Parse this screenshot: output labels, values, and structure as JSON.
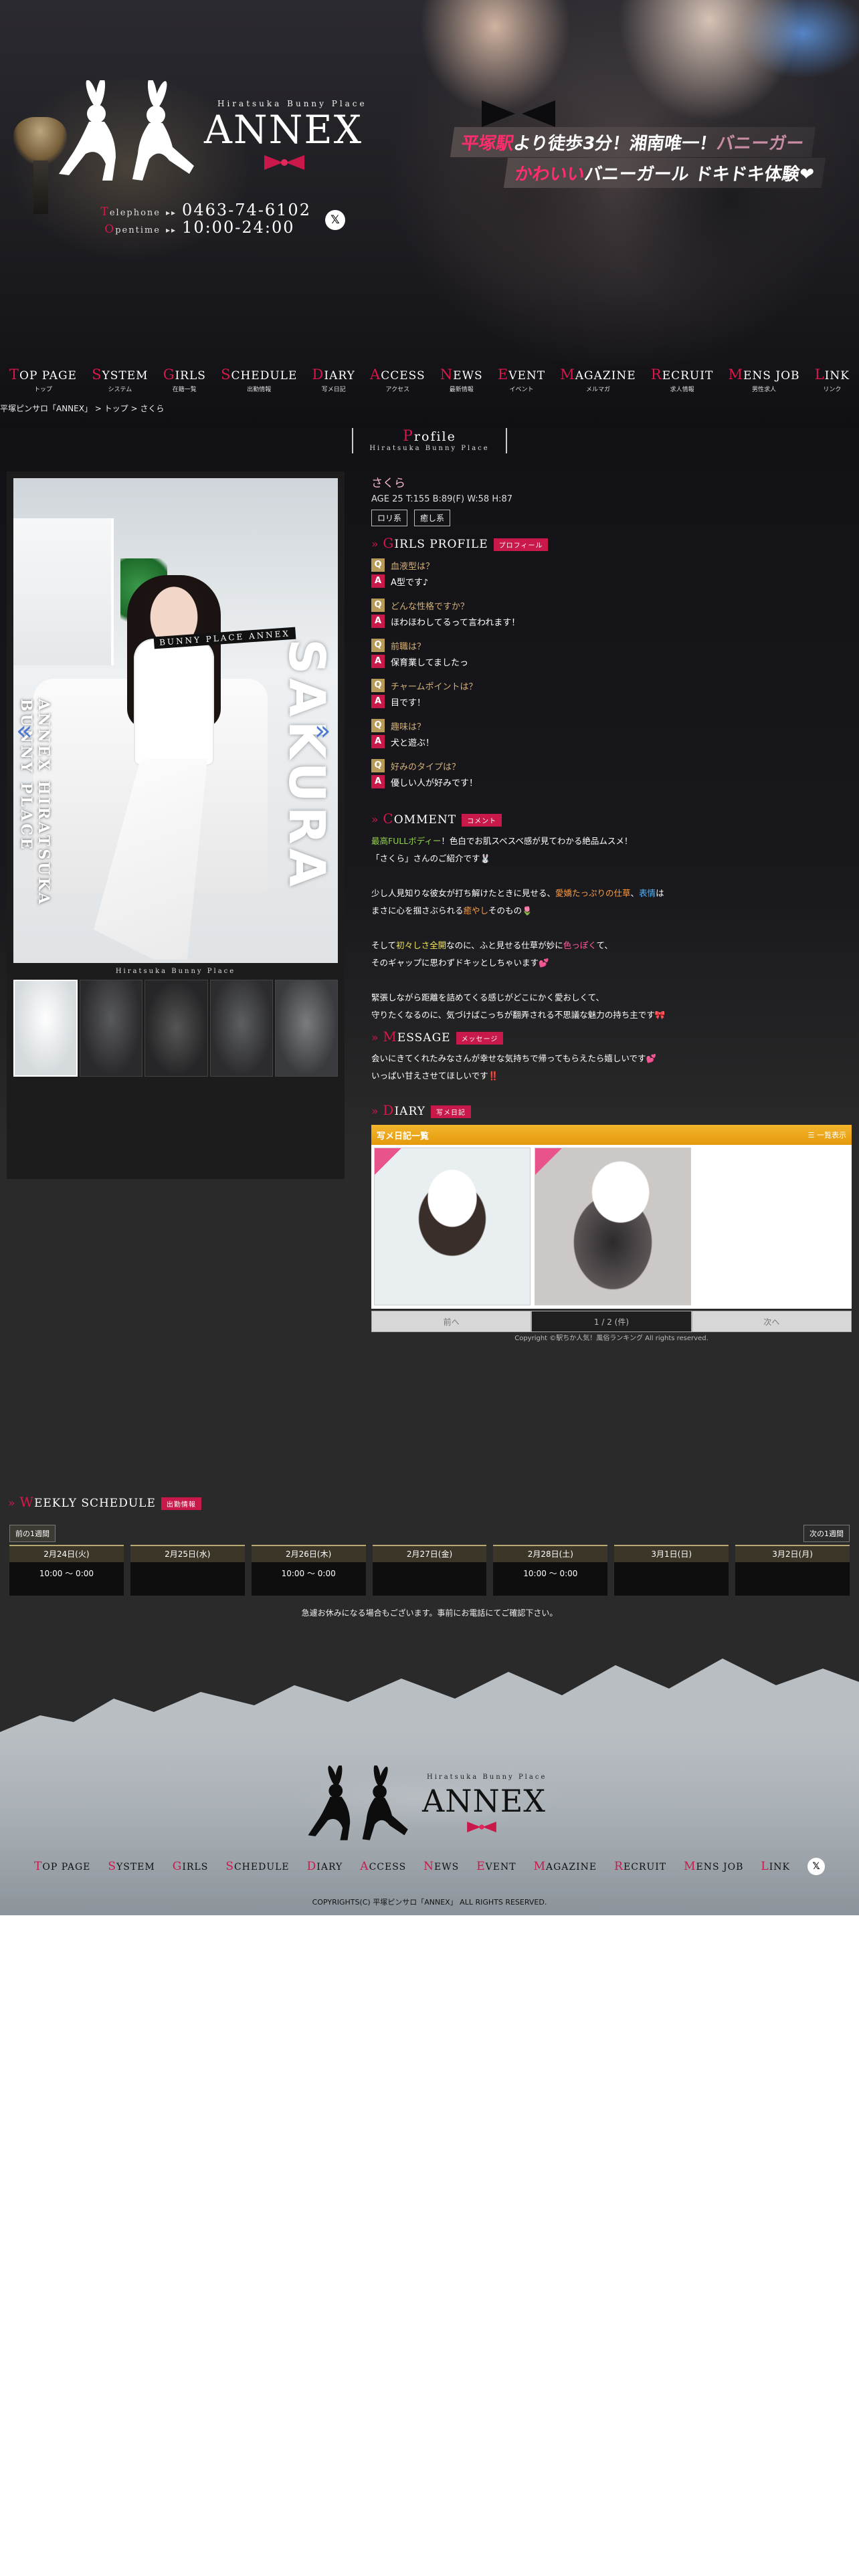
{
  "header": {
    "logo_sub": "Hiratsuka Bunny Place",
    "logo_main": "ANNEX",
    "telephone_label": "Telephone",
    "telephone": "0463-74-6102",
    "opentime_label": "Opentime",
    "opentime": "10:00-24:00",
    "catch_1_pre": "平塚駅",
    "catch_1_main": "より徒歩3分！湘南唯一！",
    "catch_1_post": "バニーガー",
    "catch_2_pre": "かわいい",
    "catch_2_main": "バニーガール",
    "catch_2_post": "ドキドキ体験❤",
    "x_icon": "x-logo-icon"
  },
  "nav": [
    {
      "cap": "T",
      "rest": "OP PAGE",
      "ja": "トップ"
    },
    {
      "cap": "S",
      "rest": "YSTEM",
      "ja": "システム"
    },
    {
      "cap": "G",
      "rest": "IRLS",
      "ja": "在籍一覧"
    },
    {
      "cap": "S",
      "rest": "CHEDULE",
      "ja": "出勤情報"
    },
    {
      "cap": "D",
      "rest": "IARY",
      "ja": "写メ日記"
    },
    {
      "cap": "A",
      "rest": "CCESS",
      "ja": "アクセス"
    },
    {
      "cap": "N",
      "rest": "EWS",
      "ja": "最新情報"
    },
    {
      "cap": "E",
      "rest": "VENT",
      "ja": "イベント"
    },
    {
      "cap": "M",
      "rest": "AGAZINE",
      "ja": "メルマガ"
    },
    {
      "cap": "R",
      "rest": "ECRUIT",
      "ja": "求人情報"
    },
    {
      "cap": "M",
      "rest": "ENS JOB",
      "ja": "男性求人"
    },
    {
      "cap": "L",
      "rest": "INK",
      "ja": "リンク"
    }
  ],
  "breadcrumb": {
    "shop": "平塚ピンサロ「ANNEX」",
    "sep1": " > ",
    "top": "トップ",
    "sep2": " > ",
    "current": "さくら"
  },
  "profile": {
    "title": "Profile",
    "title_sub": "Hiratsuka Bunny Place",
    "name": "さくら",
    "stats": "AGE 25 T:155 B:89(F) W:58 H:87",
    "tags": [
      "ロリ系",
      "癒し系"
    ]
  },
  "photo": {
    "label": "BUNNY PLACE ANNEX",
    "vertical_text": "ANNEX HIRATSUKA BUNNY PLACE",
    "big_name": "SAKURA",
    "prev_icon": "chevron-left-icon",
    "next_icon": "chevron-right-icon",
    "caption": "Hiratsuka Bunny Place"
  },
  "girls_profile": {
    "cap": "G",
    "title": "IRLS PROFILE",
    "badge": "プロフィール",
    "qa": [
      {
        "q": "血液型は？",
        "a": "A型です♪"
      },
      {
        "q": "どんな性格ですか？",
        "a": "ほわほわしてるって言われます！"
      },
      {
        "q": "前職は？",
        "a": "保育業してましたっ"
      },
      {
        "q": "チャームポイントは？",
        "a": "目です！"
      },
      {
        "q": "趣味は？",
        "a": "犬と遊ぶ！"
      },
      {
        "q": "好みのタイプは？",
        "a": "優しい人が好みです！"
      }
    ],
    "q_mark": "Q",
    "a_mark": "A"
  },
  "comment": {
    "cap": "C",
    "title": "OMMENT",
    "badge": "コメント",
    "p1_a": "最高FULLボディー",
    "p1_b": "！色白でお肌スベスベ感が見てわかる絶品ムスメ！",
    "p1_c": "「さくら」さんのご紹介です🐰",
    "p2_a": "少し人見知りな彼女が打ち解けたときに見せる、",
    "p2_b": "愛嬌たっぷりの仕草",
    "p2_c": "、",
    "p2_d": "表情",
    "p2_e": "は",
    "p2_f": "まさに心を掴さぶられる",
    "p2_g": "癒やし",
    "p2_h": "そのもの🌷",
    "p3_a": "そして",
    "p3_b": "初々しさ全開",
    "p3_c": "なのに、ふと見せる仕草が妙に",
    "p3_d": "色っぽく",
    "p3_e": "て、",
    "p3_f": "そのギャップに思わずドキッとしちゃいます💕",
    "p4_a": "緊張しながら距離を詰めてくる感じがどこにかく愛おしくて、",
    "p4_b": "守りたくなるのに、気づけばこっちが翻弄される不思議な魅力の持ち主です🎀"
  },
  "message": {
    "cap": "M",
    "title": "ESSAGE",
    "badge": "メッセージ",
    "line1": "会いにきてくれたみなさんが幸せな気持ちで帰ってもらえたら嬉しいです💕",
    "line2": "いっぱい甘えさせてほしいです‼️"
  },
  "diary": {
    "cap": "D",
    "title": "IARY",
    "badge": "写メ日記",
    "bar_title": "写メ日記一覧",
    "bar_right": "一覧表示",
    "prev": "前へ",
    "page": "1 / 2 (件)",
    "next": "次へ",
    "credit_a": "Copyright",
    "credit_b": "©駅ちか人気！風俗ランキング",
    "credit_c": " All rights reserved."
  },
  "weekly": {
    "cap": "W",
    "title": "EEKLY SCHEDULE",
    "badge": "出勤情報",
    "prev": "前の1週間",
    "next": "次の1週間",
    "days": [
      {
        "date": "2月24日(火)",
        "time": "10:00 〜  0:00"
      },
      {
        "date": "2月25日(水)",
        "time": ""
      },
      {
        "date": "2月26日(木)",
        "time": "10:00 〜  0:00"
      },
      {
        "date": "2月27日(金)",
        "time": ""
      },
      {
        "date": "2月28日(土)",
        "time": "10:00 〜  0:00"
      },
      {
        "date": "3月1日(日)",
        "time": ""
      },
      {
        "date": "3月2日(月)",
        "time": ""
      }
    ],
    "note": "急遽お休みになる場合もございます。事前にお電話にてご確認下さい。"
  },
  "footer": {
    "logo_sub": "Hiratsuka Bunny Place",
    "logo_main": "ANNEX",
    "nav": [
      {
        "cap": "T",
        "rest": "OP PAGE"
      },
      {
        "cap": "S",
        "rest": "YSTEM"
      },
      {
        "cap": "G",
        "rest": "IRLS"
      },
      {
        "cap": "S",
        "rest": "CHEDULE"
      },
      {
        "cap": "D",
        "rest": "IARY"
      },
      {
        "cap": "A",
        "rest": "CCESS"
      },
      {
        "cap": "N",
        "rest": "EWS"
      },
      {
        "cap": "E",
        "rest": "VENT"
      },
      {
        "cap": "M",
        "rest": "AGAZINE"
      },
      {
        "cap": "R",
        "rest": "ECRUIT"
      },
      {
        "cap": "M",
        "rest": "ENS JOB"
      },
      {
        "cap": "L",
        "rest": "INK"
      }
    ],
    "copyright": "COPYRIGHTS(C) 平塚ピンサロ「ANNEX」 ALL RIGHTS RESERVED.",
    "x_icon": "x-logo-icon"
  },
  "colors": {
    "accent_red": "#c8194a",
    "gold": "#b89a58",
    "diary_orange": "#f3b52c"
  }
}
